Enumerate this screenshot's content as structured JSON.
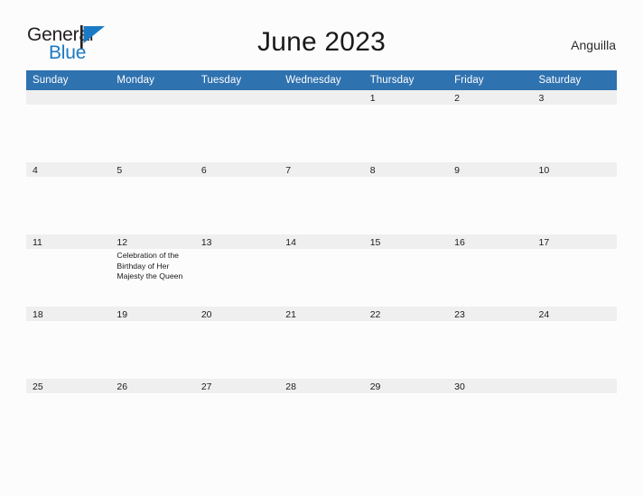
{
  "brand": {
    "word1": "General",
    "word2": "Blue",
    "flag_icon": "flag-triangle-icon",
    "word1_color": "#231f20",
    "word2_color": "#1b7ac4",
    "flag_color": "#1b7ac4"
  },
  "header": {
    "title": "June 2023",
    "location": "Anguilla"
  },
  "theme": {
    "header_blue": "#2f72b0",
    "date_band": "#efefef",
    "page_background": "#fcfcfc",
    "text": "#1a1a1a"
  },
  "calendar": {
    "weekday_headers": [
      "Sunday",
      "Monday",
      "Tuesday",
      "Wednesday",
      "Thursday",
      "Friday",
      "Saturday"
    ],
    "weeks": [
      [
        {
          "date": "",
          "events": []
        },
        {
          "date": "",
          "events": []
        },
        {
          "date": "",
          "events": []
        },
        {
          "date": "",
          "events": []
        },
        {
          "date": "1",
          "events": []
        },
        {
          "date": "2",
          "events": []
        },
        {
          "date": "3",
          "events": []
        }
      ],
      [
        {
          "date": "4",
          "events": []
        },
        {
          "date": "5",
          "events": []
        },
        {
          "date": "6",
          "events": []
        },
        {
          "date": "7",
          "events": []
        },
        {
          "date": "8",
          "events": []
        },
        {
          "date": "9",
          "events": []
        },
        {
          "date": "10",
          "events": []
        }
      ],
      [
        {
          "date": "11",
          "events": []
        },
        {
          "date": "12",
          "events": [
            "Celebration of the Birthday of Her Majesty the Queen"
          ]
        },
        {
          "date": "13",
          "events": []
        },
        {
          "date": "14",
          "events": []
        },
        {
          "date": "15",
          "events": []
        },
        {
          "date": "16",
          "events": []
        },
        {
          "date": "17",
          "events": []
        }
      ],
      [
        {
          "date": "18",
          "events": []
        },
        {
          "date": "19",
          "events": []
        },
        {
          "date": "20",
          "events": []
        },
        {
          "date": "21",
          "events": []
        },
        {
          "date": "22",
          "events": []
        },
        {
          "date": "23",
          "events": []
        },
        {
          "date": "24",
          "events": []
        }
      ],
      [
        {
          "date": "25",
          "events": []
        },
        {
          "date": "26",
          "events": []
        },
        {
          "date": "27",
          "events": []
        },
        {
          "date": "28",
          "events": []
        },
        {
          "date": "29",
          "events": []
        },
        {
          "date": "30",
          "events": []
        },
        {
          "date": "",
          "events": []
        }
      ]
    ]
  }
}
